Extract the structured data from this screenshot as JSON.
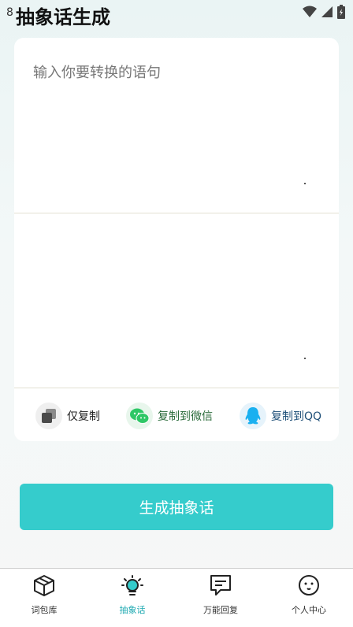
{
  "status_bar": {
    "time": "8"
  },
  "app": {
    "title": "抽象话生成"
  },
  "input": {
    "placeholder": "输入你要转换的语句",
    "value": ""
  },
  "output": {
    "value": ""
  },
  "actions": [
    {
      "label": "仅复制",
      "icon": "copy-icon",
      "color": "#222222"
    },
    {
      "label": "复制到微信",
      "icon": "wechat-icon",
      "color": "#2a6b3a"
    },
    {
      "label": "复制到QQ",
      "icon": "qq-icon",
      "color": "#1e4f78"
    }
  ],
  "generate_button": {
    "label": "生成抽象话"
  },
  "nav": [
    {
      "label": "词包库",
      "icon": "box-icon"
    },
    {
      "label": "抽象话",
      "icon": "lightbulb-icon",
      "active": true
    },
    {
      "label": "万能回复",
      "icon": "chat-icon"
    },
    {
      "label": "个人中心",
      "icon": "face-icon"
    }
  ],
  "colors": {
    "accent": "#35cccc",
    "active_nav": "#1ba8b0",
    "wechat_green": "#2ec766",
    "qq_blue": "#1ab0f0"
  }
}
